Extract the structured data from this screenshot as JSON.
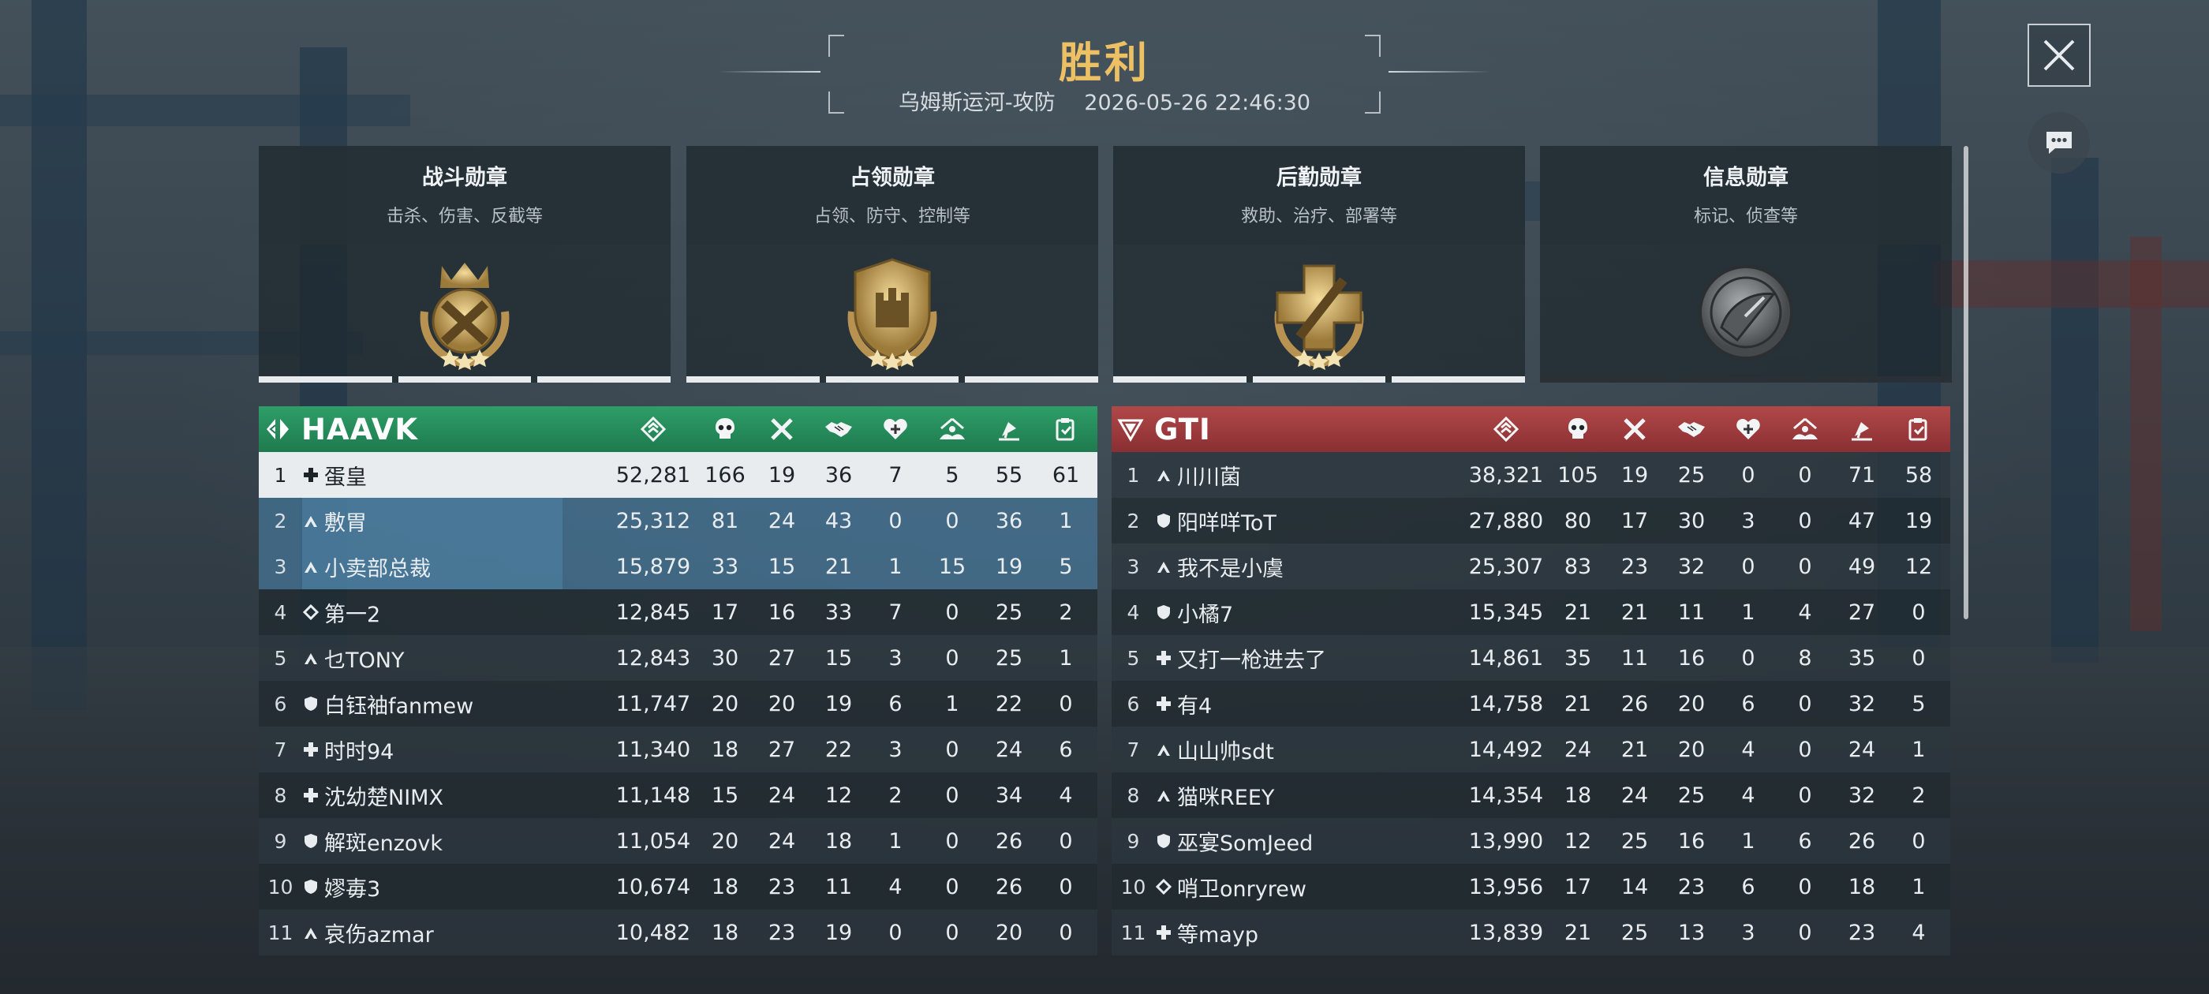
{
  "header": {
    "title": "胜利",
    "map_mode": "乌姆斯运河-攻防",
    "datetime": "2026-05-26 22:46:30"
  },
  "medals": [
    {
      "title": "战斗勋章",
      "subtitle": "击杀、伤害、反截等",
      "icon": "combat-medal-icon",
      "earned": true
    },
    {
      "title": "占领勋章",
      "subtitle": "占领、防守、控制等",
      "icon": "capture-medal-icon",
      "earned": true
    },
    {
      "title": "后勤勋章",
      "subtitle": "救助、治疗、部署等",
      "icon": "logistics-medal-icon",
      "earned": true
    },
    {
      "title": "信息勋章",
      "subtitle": "标记、侦查等",
      "icon": "intel-medal-icon",
      "earned": false
    }
  ],
  "columns": [
    "score-icon",
    "kills-icon",
    "deaths-icon",
    "assists-icon",
    "revives-icon",
    "captures-icon",
    "intel-icon",
    "support-icon"
  ],
  "teams": [
    {
      "name": "HAAVK",
      "color": "#23865a",
      "players": [
        {
          "rank": "1",
          "role": "medic",
          "name": "蛋皇",
          "stats": [
            "52,281",
            "166",
            "19",
            "36",
            "7",
            "5",
            "55",
            "61"
          ],
          "highlight": "self"
        },
        {
          "rank": "2",
          "role": "assault",
          "name": "敷胃",
          "stats": [
            "25,312",
            "81",
            "24",
            "43",
            "0",
            "0",
            "36",
            "1"
          ],
          "highlight": "mate"
        },
        {
          "rank": "3",
          "role": "assault",
          "name": "小卖部总裁",
          "stats": [
            "15,879",
            "33",
            "15",
            "21",
            "1",
            "15",
            "19",
            "5"
          ],
          "highlight": "mate"
        },
        {
          "rank": "4",
          "role": "recon",
          "name": "第一2",
          "stats": [
            "12,845",
            "17",
            "16",
            "33",
            "7",
            "0",
            "25",
            "2"
          ]
        },
        {
          "rank": "5",
          "role": "assault",
          "name": "乜TONY",
          "stats": [
            "12,843",
            "30",
            "27",
            "15",
            "3",
            "0",
            "25",
            "1"
          ]
        },
        {
          "rank": "6",
          "role": "engineer",
          "name": "白钰袖fanmew",
          "stats": [
            "11,747",
            "20",
            "20",
            "19",
            "6",
            "1",
            "22",
            "0"
          ]
        },
        {
          "rank": "7",
          "role": "medic",
          "name": "时时94",
          "stats": [
            "11,340",
            "18",
            "27",
            "22",
            "3",
            "0",
            "24",
            "6"
          ]
        },
        {
          "rank": "8",
          "role": "medic",
          "name": "沈幼楚NIMX",
          "stats": [
            "11,148",
            "15",
            "24",
            "12",
            "2",
            "0",
            "34",
            "4"
          ]
        },
        {
          "rank": "9",
          "role": "engineer",
          "name": "解斑enzovk",
          "stats": [
            "11,054",
            "20",
            "24",
            "18",
            "1",
            "0",
            "26",
            "0"
          ]
        },
        {
          "rank": "10",
          "role": "engineer",
          "name": "嫪毐3",
          "stats": [
            "10,674",
            "18",
            "23",
            "11",
            "4",
            "0",
            "26",
            "0"
          ]
        },
        {
          "rank": "11",
          "role": "assault",
          "name": "哀伤azmar",
          "stats": [
            "10,482",
            "18",
            "23",
            "19",
            "0",
            "0",
            "20",
            "0"
          ]
        }
      ]
    },
    {
      "name": "GTI",
      "color": "#9c3a3d",
      "players": [
        {
          "rank": "1",
          "role": "assault",
          "name": "川川菌",
          "stats": [
            "38,321",
            "105",
            "19",
            "25",
            "0",
            "0",
            "71",
            "58"
          ]
        },
        {
          "rank": "2",
          "role": "engineer",
          "name": "阳咩咩ToT",
          "stats": [
            "27,880",
            "80",
            "17",
            "30",
            "3",
            "0",
            "47",
            "19"
          ]
        },
        {
          "rank": "3",
          "role": "assault",
          "name": "我不是小虞",
          "stats": [
            "25,307",
            "83",
            "23",
            "32",
            "0",
            "0",
            "49",
            "12"
          ]
        },
        {
          "rank": "4",
          "role": "engineer",
          "name": "小橘7",
          "stats": [
            "15,345",
            "21",
            "21",
            "11",
            "1",
            "4",
            "27",
            "0"
          ]
        },
        {
          "rank": "5",
          "role": "medic",
          "name": "又打一枪进去了",
          "stats": [
            "14,861",
            "35",
            "11",
            "16",
            "0",
            "8",
            "35",
            "0"
          ]
        },
        {
          "rank": "6",
          "role": "medic",
          "name": "有4",
          "stats": [
            "14,758",
            "21",
            "26",
            "20",
            "6",
            "0",
            "32",
            "5"
          ]
        },
        {
          "rank": "7",
          "role": "assault",
          "name": "山山帅sdt",
          "stats": [
            "14,492",
            "24",
            "21",
            "20",
            "4",
            "0",
            "24",
            "1"
          ]
        },
        {
          "rank": "8",
          "role": "assault",
          "name": "猫咪REEY",
          "stats": [
            "14,354",
            "18",
            "24",
            "25",
            "4",
            "0",
            "32",
            "2"
          ]
        },
        {
          "rank": "9",
          "role": "engineer",
          "name": "巫宴SomJeed",
          "stats": [
            "13,990",
            "12",
            "25",
            "16",
            "1",
            "6",
            "26",
            "0"
          ]
        },
        {
          "rank": "10",
          "role": "recon",
          "name": "哨卫onryrew",
          "stats": [
            "13,956",
            "17",
            "14",
            "23",
            "6",
            "0",
            "18",
            "1"
          ]
        },
        {
          "rank": "11",
          "role": "medic",
          "name": "等mayp",
          "stats": [
            "13,839",
            "21",
            "25",
            "13",
            "3",
            "0",
            "23",
            "4"
          ]
        }
      ]
    }
  ]
}
